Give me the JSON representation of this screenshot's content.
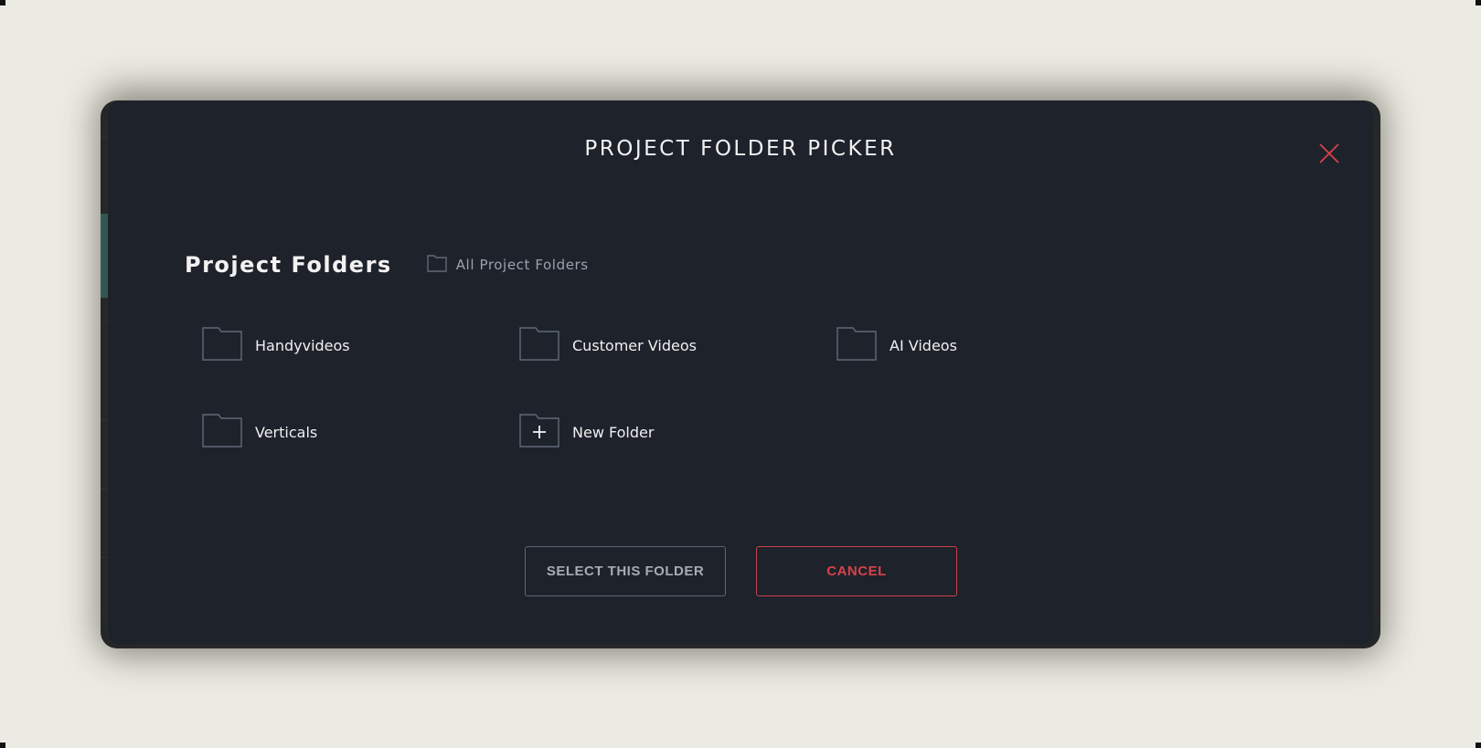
{
  "modal": {
    "title": "PROJECT FOLDER PICKER",
    "close_icon": "close-icon"
  },
  "section": {
    "title": "Project Folders",
    "breadcrumb": {
      "icon": "folder-icon",
      "label": "All Project Folders"
    }
  },
  "folders": [
    {
      "label": "Handyvideos",
      "icon": "folder-icon"
    },
    {
      "label": "Customer Videos",
      "icon": "folder-icon"
    },
    {
      "label": "AI Videos",
      "icon": "folder-icon"
    },
    {
      "label": "Verticals",
      "icon": "folder-icon"
    },
    {
      "label": "New Folder",
      "icon": "folder-plus-icon"
    }
  ],
  "actions": {
    "select_label": "SELECT THIS FOLDER",
    "cancel_label": "CANCEL"
  },
  "colors": {
    "page_background": "#ebebe4",
    "modal_background": "#1e222b",
    "folder_outline": "#5f6b77",
    "accent_red": "#d8424a",
    "text_primary": "#f0f0f0",
    "text_muted": "#9aa3ad"
  }
}
